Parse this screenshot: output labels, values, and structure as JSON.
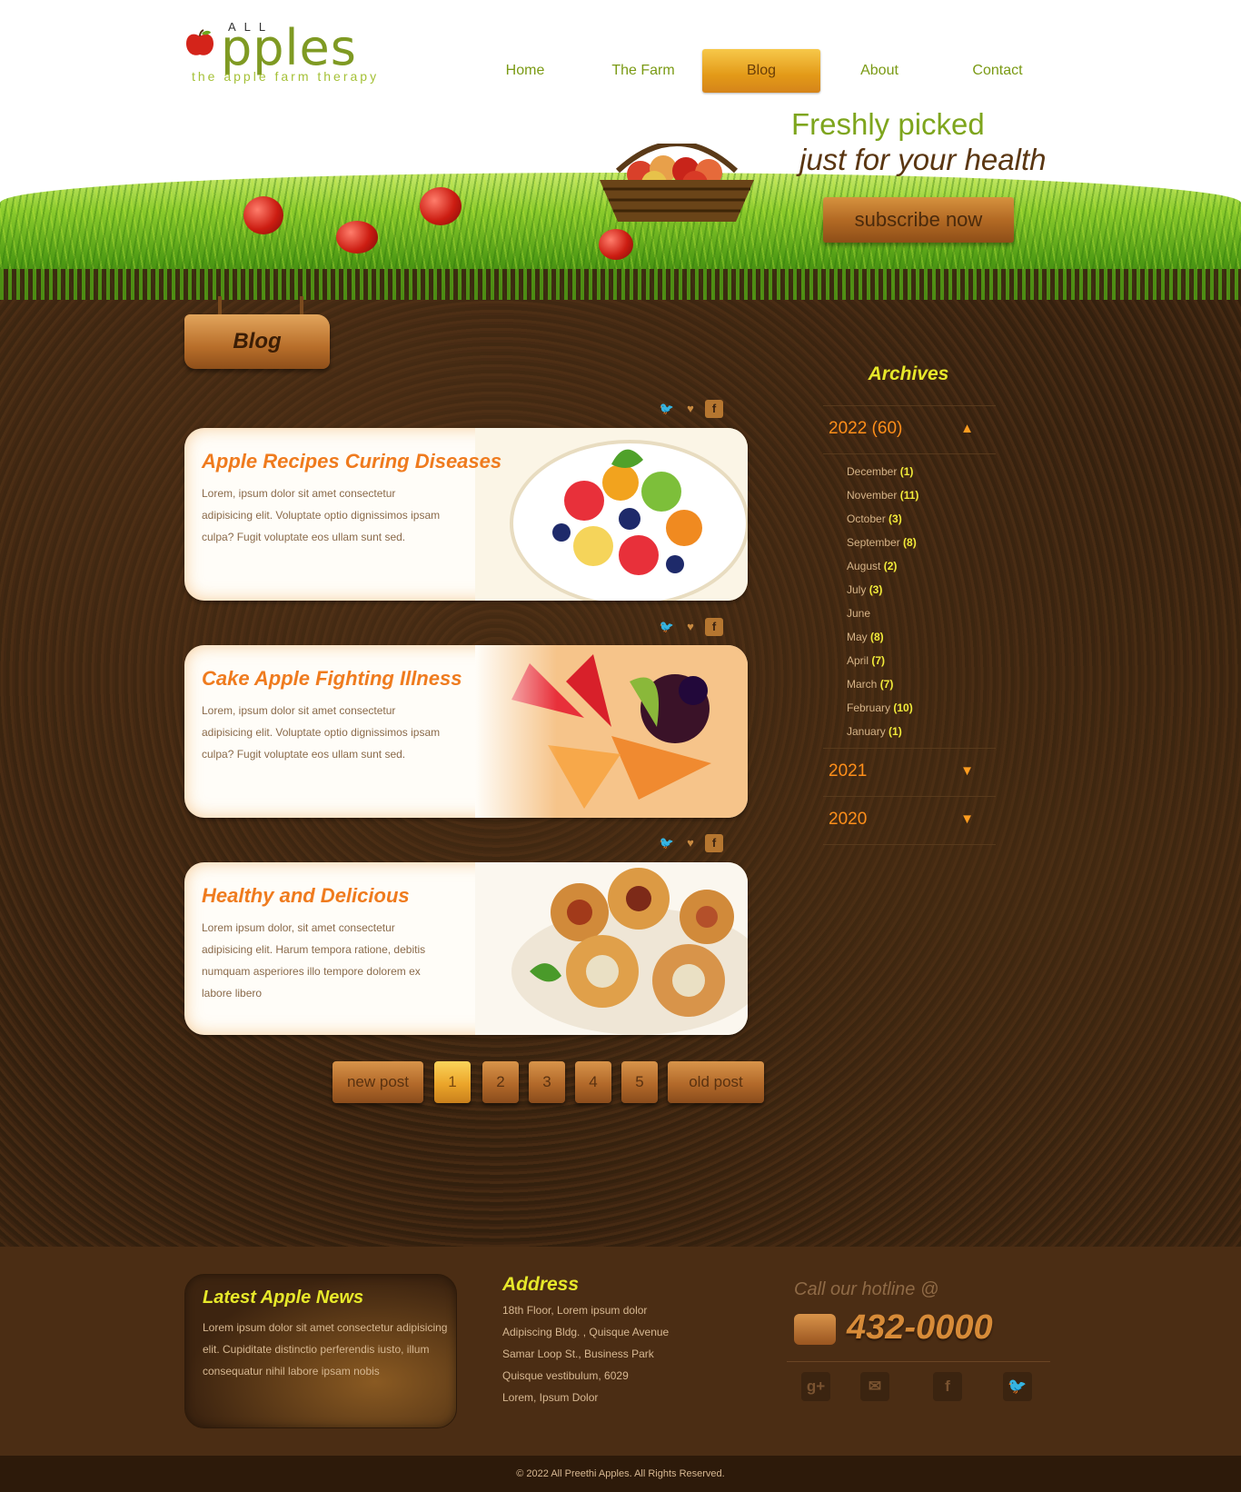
{
  "logo": {
    "all": "ALL",
    "word": "pples",
    "tagline": "the apple farm therapy"
  },
  "nav": [
    {
      "label": "Home"
    },
    {
      "label": "The Farm"
    },
    {
      "label": "Blog",
      "active": true
    },
    {
      "label": "About"
    },
    {
      "label": "Contact"
    }
  ],
  "hero": {
    "tagline_1": "Freshly picked",
    "tagline_2": "just for your health",
    "subscribe": "subscribe now"
  },
  "page_title": "Blog",
  "posts": [
    {
      "title": "Apple Recipes Curing Diseases",
      "text": "Lorem, ipsum dolor sit amet consectetur adipisicing elit. Voluptate optio dignissimos ipsam culpa? Fugit voluptate eos ullam sunt sed.",
      "image": "fruit-salad"
    },
    {
      "title": "Cake Apple Fighting Illness",
      "text": "Lorem, ipsum dolor sit amet consectetur adipisicing elit. Voluptate optio dignissimos ipsam culpa? Fugit voluptate eos ullam sunt sed.",
      "image": "fruit-tart"
    },
    {
      "title": "Healthy and Delicious",
      "text": "Lorem ipsum dolor, sit amet consectetur adipisicing elit. Harum tempora ratione, debitis numquam asperiores illo tempore dolorem ex labore libero",
      "image": "pastry-puffs"
    }
  ],
  "share_icons": [
    "twitter-icon",
    "heart-icon",
    "facebook-icon"
  ],
  "pagination": {
    "new": "new post",
    "pages": [
      "1",
      "2",
      "3",
      "4",
      "5"
    ],
    "current": "1",
    "old": "old post"
  },
  "archives": {
    "title": "Archives",
    "open_year": {
      "label": "2022 (60)",
      "arrow": "▲"
    },
    "months": [
      {
        "name": "December",
        "count": "(1)"
      },
      {
        "name": "November",
        "count": "(11)"
      },
      {
        "name": "October",
        "count": "(3)"
      },
      {
        "name": "September",
        "count": "(8)"
      },
      {
        "name": "August",
        "count": "(2)"
      },
      {
        "name": "July",
        "count": "(3)"
      },
      {
        "name": "June",
        "count": ""
      },
      {
        "name": "May",
        "count": "(8)"
      },
      {
        "name": "April",
        "count": "(7)"
      },
      {
        "name": "March",
        "count": "(7)"
      },
      {
        "name": "February",
        "count": "(10)"
      },
      {
        "name": "January",
        "count": "(1)"
      }
    ],
    "closed_years": [
      {
        "label": "2021",
        "arrow": "▼"
      },
      {
        "label": "2020",
        "arrow": "▼"
      }
    ]
  },
  "footer": {
    "news_title": "Latest Apple News",
    "news_text": "Lorem ipsum dolor sit amet consectetur adipisicing elit. Cupiditate distinctio perferendis iusto, illum consequatur nihil labore ipsam nobis",
    "address_title": "Address",
    "address_lines": [
      "18th Floor, Lorem ipsum dolor",
      "Adipiscing Bldg. , Quisque Avenue",
      "Samar Loop St., Business Park",
      "Quisque vestibulum, 6029",
      "Lorem, Ipsum Dolor"
    ],
    "hotline_title": "Call our hotline @",
    "hotline_number": "432-0000",
    "social": [
      {
        "icon": "google-plus-icon",
        "glyph": "g+"
      },
      {
        "icon": "mail-icon",
        "glyph": "✉"
      },
      {
        "icon": "facebook-icon",
        "glyph": "f"
      },
      {
        "icon": "twitter-icon",
        "glyph": "🐦"
      }
    ],
    "copyright": "© 2022 All Preethi Apples. All Rights Reserved."
  },
  "colors": {
    "accent_orange": "#ef7b1e",
    "title_yellow": "#e7e82a",
    "nav_green": "#7a9a14",
    "soil": "#3d2412"
  }
}
